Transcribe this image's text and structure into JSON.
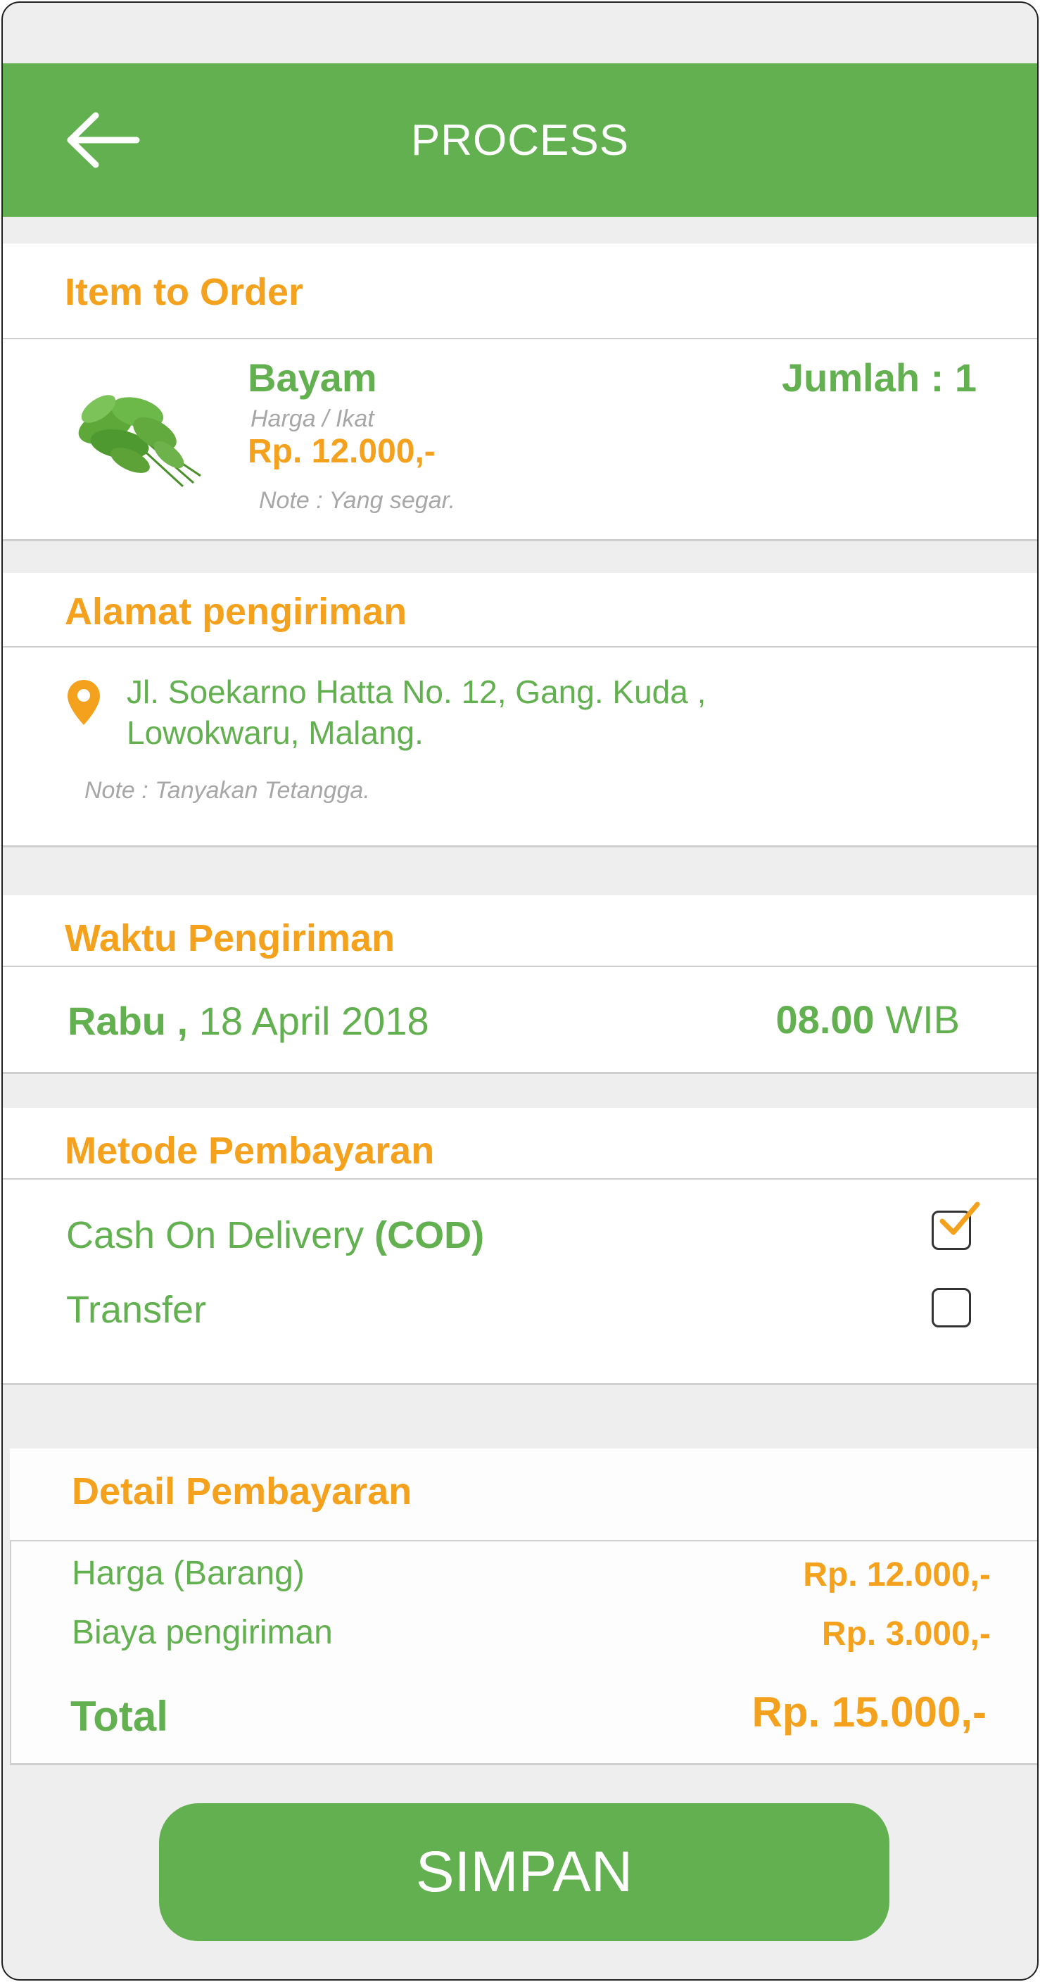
{
  "header": {
    "title": "PROCESS",
    "back_icon": "arrow-left-icon"
  },
  "item_section": {
    "title": "Item to Order",
    "item": {
      "name": "Bayam",
      "unit": "Harga / Ikat",
      "price": "Rp. 12.000,-",
      "note": "Note : Yang segar.",
      "quantity": "Jumlah : 1",
      "image": "spinach-image"
    }
  },
  "address_section": {
    "title": "Alamat pengiriman",
    "icon": "location-pin-icon",
    "address_line1": "Jl. Soekarno Hatta No. 12, Gang. Kuda ,",
    "address_line2": "Lowokwaru, Malang.",
    "note": "Note : Tanyakan Tetangga."
  },
  "delivery_time": {
    "title": "Waktu Pengiriman",
    "day": "Rabu ,",
    "date": "18 April 2018",
    "time": "08.00",
    "zone": "WIB"
  },
  "payment_method": {
    "title": "Metode Pembayaran",
    "options": [
      {
        "label": "Cash On Delivery",
        "label_bold": "(COD)",
        "checked": true
      },
      {
        "label": "Transfer",
        "label_bold": "",
        "checked": false
      }
    ]
  },
  "payment_detail": {
    "title": "Detail Pembayaran",
    "rows": [
      {
        "label": "Harga (Barang)",
        "value": "Rp. 12.000,-"
      },
      {
        "label": "Biaya pengiriman",
        "value": "Rp. 3.000,-"
      }
    ],
    "total_label": "Total",
    "total_value": "Rp. 15.000,-"
  },
  "save_button": {
    "label": "SIMPAN"
  },
  "colors": {
    "primary_green": "#62b04f",
    "accent_orange": "#f4a21d",
    "background": "#eeeeee"
  }
}
